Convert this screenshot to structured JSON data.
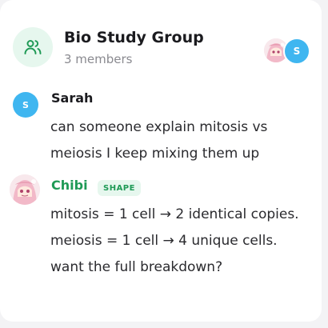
{
  "group": {
    "title": "Bio Study Group",
    "members": "3 members",
    "icon": "users-icon"
  },
  "header_avatars": [
    {
      "type": "image",
      "name": "chibi-avatar"
    },
    {
      "type": "initial",
      "text": "S",
      "color": "#3fb6f0"
    }
  ],
  "messages": [
    {
      "sender": "Sarah",
      "avatar_initial": "S",
      "avatar_color": "#3fb6f0",
      "text": "can someone explain mitosis vs meiosis I keep mixing them up"
    },
    {
      "sender": "Chibi",
      "sender_color": "#1f9a56",
      "badge": "SHAPE",
      "avatar": "chibi-avatar",
      "text": "mitosis = 1 cell → 2 identical copies. meiosis = 1 cell → 4 unique cells. want the full breakdown?"
    }
  ],
  "colors": {
    "accent_green": "#1f9a56",
    "avatar_blue": "#3fb6f0",
    "badge_bg": "#e6f7ee"
  }
}
